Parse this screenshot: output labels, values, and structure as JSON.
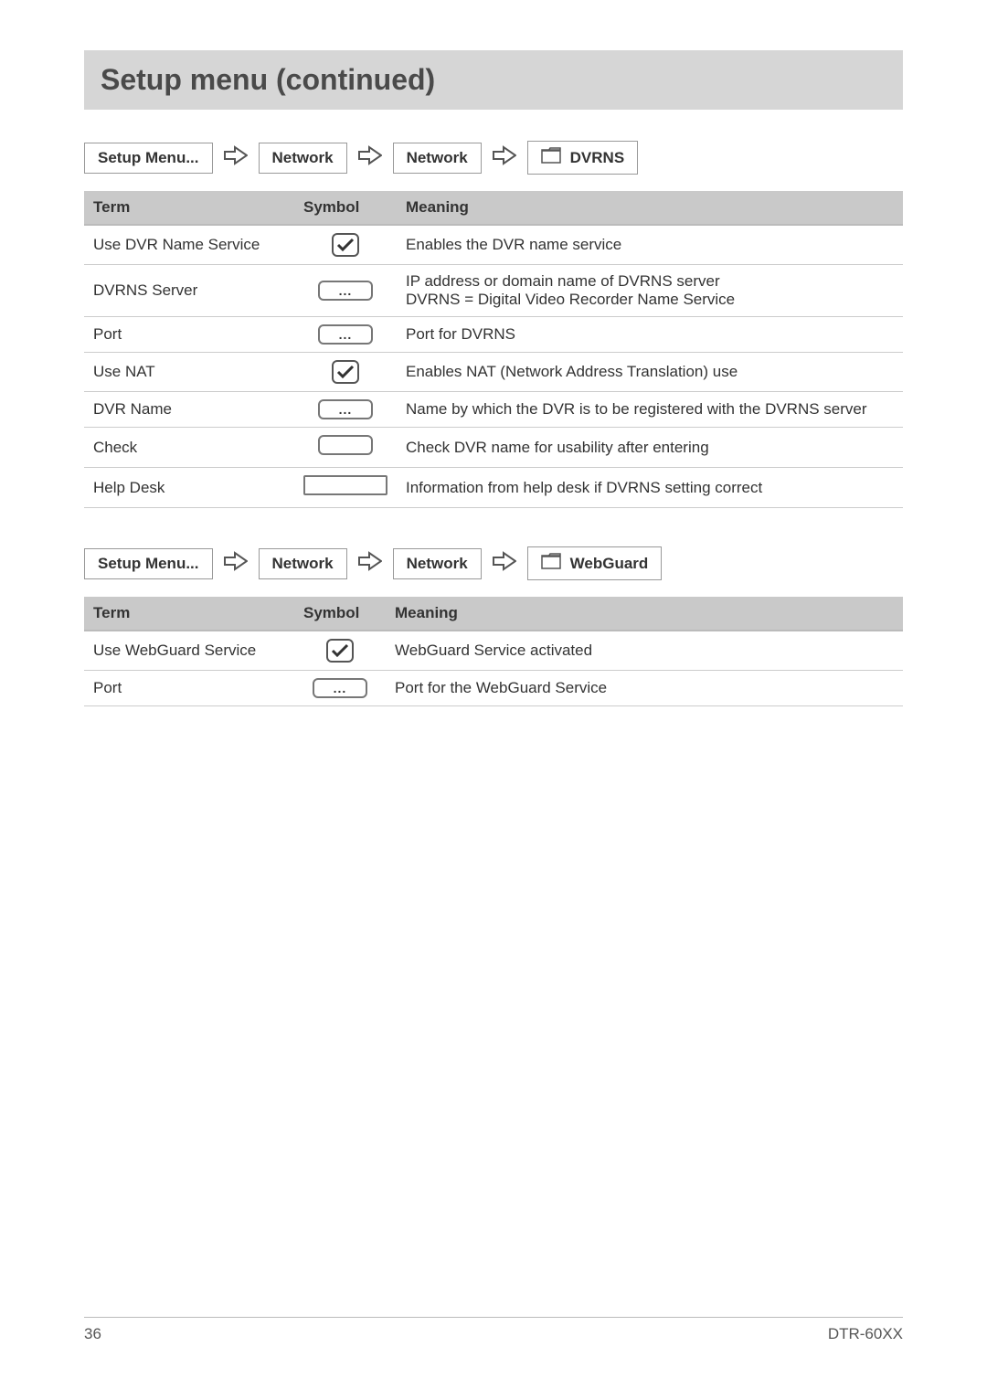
{
  "title": "Setup menu (continued)",
  "breadcrumb1": {
    "step1": "Setup Menu...",
    "step2": "Network",
    "step3": "Network",
    "final": "DVRNS"
  },
  "columns": {
    "term": "Term",
    "symbol": "Symbol",
    "meaning": "Meaning"
  },
  "table1": [
    {
      "term": "Use DVR Name Service",
      "symbol": "check",
      "meaning": "Enables the DVR name service"
    },
    {
      "term": "DVRNS Server",
      "symbol": "dots",
      "meaning": "IP address or domain name of DVRNS server\nDVRNS = Digital Video Recorder Name Service"
    },
    {
      "term": "Port",
      "symbol": "dots",
      "meaning": "Port for DVRNS"
    },
    {
      "term": "Use NAT",
      "symbol": "check",
      "meaning": "Enables NAT (Network Address Translation) use"
    },
    {
      "term": "DVR Name",
      "symbol": "dots",
      "meaning": "Name by which the DVR is to be registered with the DVRNS server"
    },
    {
      "term": "Check",
      "symbol": "blank",
      "meaning": "Check DVR name for usability after entering"
    },
    {
      "term": "Help Desk",
      "symbol": "wide",
      "meaning": "Information from help desk if DVRNS setting correct"
    }
  ],
  "breadcrumb2": {
    "step1": "Setup Menu...",
    "step2": "Network",
    "step3": "Network",
    "final": "WebGuard"
  },
  "table2": [
    {
      "term": "Use WebGuard Service",
      "symbol": "check",
      "meaning": "WebGuard Service activated"
    },
    {
      "term": "Port",
      "symbol": "dots",
      "meaning": "Port for the WebGuard Service"
    }
  ],
  "footer": {
    "page": "36",
    "model": "DTR-60XX"
  },
  "glyphs": {
    "dots": "..."
  }
}
